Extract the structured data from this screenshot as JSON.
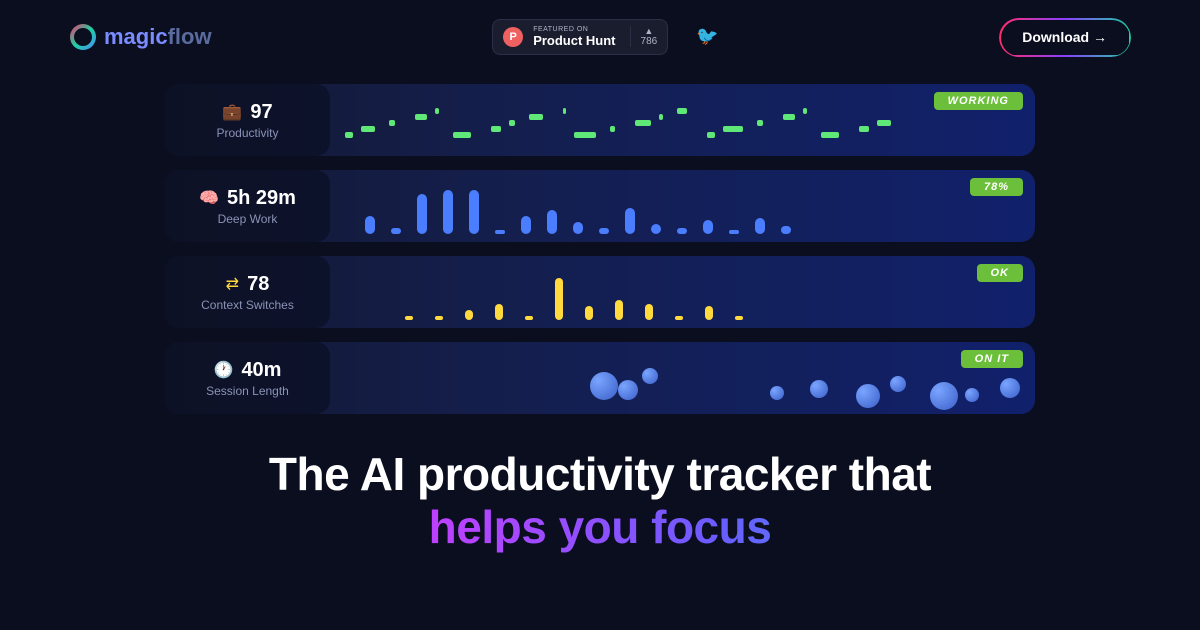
{
  "brand": {
    "magic": "magic",
    "flow": "flow"
  },
  "productHunt": {
    "featured": "FEATURED ON",
    "name": "Product Hunt",
    "count": "786",
    "iconLetter": "P"
  },
  "download": {
    "label": "Download →"
  },
  "metrics": [
    {
      "icon": "💼",
      "value": "97",
      "name": "Productivity",
      "status": "WORKING",
      "iconColor": "#5fe877"
    },
    {
      "icon": "🧠",
      "value": "5h 29m",
      "name": "Deep Work",
      "status": "78%",
      "iconColor": "#4a7eff"
    },
    {
      "icon": "⇄",
      "value": "78",
      "name": "Context Switches",
      "status": "OK",
      "iconColor": "#ffd93d"
    },
    {
      "icon": "🕐",
      "value": "40m",
      "name": "Session Length",
      "status": "ON IT",
      "iconColor": "#4a7eff"
    }
  ],
  "headline": {
    "line1": "The AI productivity tracker that",
    "line2": "helps you focus"
  },
  "chart_data": [
    {
      "type": "bar",
      "title": "Productivity activity segments",
      "values": [
        8,
        14,
        6,
        12,
        4,
        18,
        10,
        6,
        14,
        3,
        22,
        5,
        16,
        4,
        10,
        8,
        20,
        6,
        12,
        4,
        18,
        10,
        14
      ],
      "note": "segment widths (px), rendered as green horizontal ticks"
    },
    {
      "type": "bar",
      "title": "Deep Work intervals",
      "values": [
        18,
        6,
        40,
        44,
        44,
        4,
        18,
        24,
        12,
        6,
        26,
        10,
        6,
        14,
        4,
        16,
        8
      ],
      "ylim": [
        0,
        50
      ]
    },
    {
      "type": "bar",
      "title": "Context Switches",
      "values": [
        4,
        4,
        10,
        16,
        4,
        42,
        14,
        20,
        16,
        4,
        14,
        4
      ],
      "ylim": [
        0,
        50
      ]
    },
    {
      "type": "scatter",
      "title": "Session bubbles",
      "points": [
        {
          "x": 80,
          "y": 22,
          "r": 14
        },
        {
          "x": 108,
          "y": 30,
          "r": 10
        },
        {
          "x": 132,
          "y": 18,
          "r": 8
        },
        {
          "x": 260,
          "y": 36,
          "r": 7
        },
        {
          "x": 300,
          "y": 30,
          "r": 9
        },
        {
          "x": 346,
          "y": 34,
          "r": 12
        },
        {
          "x": 380,
          "y": 26,
          "r": 8
        },
        {
          "x": 420,
          "y": 32,
          "r": 14
        },
        {
          "x": 455,
          "y": 38,
          "r": 7
        },
        {
          "x": 490,
          "y": 28,
          "r": 10
        },
        {
          "x": 540,
          "y": 20,
          "r": 9
        }
      ]
    }
  ]
}
